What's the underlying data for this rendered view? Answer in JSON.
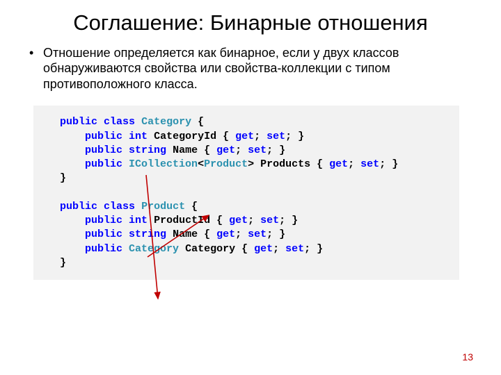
{
  "title": "Соглашение: Бинарные отношения",
  "bullet": "Отношение определяется как бинарное, если у двух классов обнаруживаются свойства или свойства-коллекции с типом противоположного класса.",
  "code": {
    "kw": {
      "public": "public",
      "class": "class",
      "int": "int",
      "string": "string",
      "get": "get",
      "set": "set"
    },
    "cls": {
      "Category": "Category",
      "ICollection": "ICollection",
      "Product": "Product"
    },
    "txt": {
      "openBrace": " {",
      "closeBrace": "}",
      "CategoryId": " CategoryId { ",
      "Name": " Name { ",
      "Products_a": "<",
      "Products_b": "> Products { ",
      "ProductId": " ProductId { ",
      "Category_prop": " Category { ",
      "semi": "; ",
      "semiEnd": "; }"
    }
  },
  "page_number": "13",
  "arrow_color": "#c00000"
}
